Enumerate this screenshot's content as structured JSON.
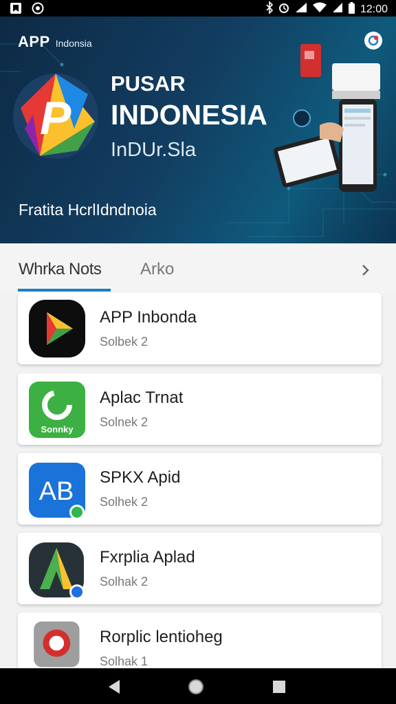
{
  "status_bar": {
    "time": "12:00"
  },
  "hero": {
    "brand_main": "APP",
    "brand_sub": "Indonsia",
    "title_line1": "PUSAR",
    "title_line2": "INDONESIA",
    "title_line3": "InDUr.Sla",
    "tagline": "Fratita HcrlIdndnoia",
    "colors": {
      "bg": "#123d60",
      "accent": "#1a7ec4"
    }
  },
  "tabs": [
    {
      "label": "Whrka Nots",
      "active": true
    },
    {
      "label": "Arko",
      "active": false
    }
  ],
  "apps": [
    {
      "name": "APP Inbonda",
      "subtitle": "Solbek 2",
      "icon": "play-triangle-app-icon"
    },
    {
      "name": "Aplac Trnat",
      "subtitle": "Solnek 2",
      "icon": "green-sync-app-icon",
      "icon_text": "Sonnky"
    },
    {
      "name": "SPKX Apid",
      "subtitle": "Solhek 2",
      "icon": "blue-ab-app-icon",
      "icon_text": "AB"
    },
    {
      "name": "Fxrplia Aplad",
      "subtitle": "Solhak 2",
      "icon": "green-a-app-icon"
    },
    {
      "name": "Rorplic lentioheg",
      "subtitle": "Solhak 1",
      "icon": "red-circle-app-icon"
    }
  ]
}
